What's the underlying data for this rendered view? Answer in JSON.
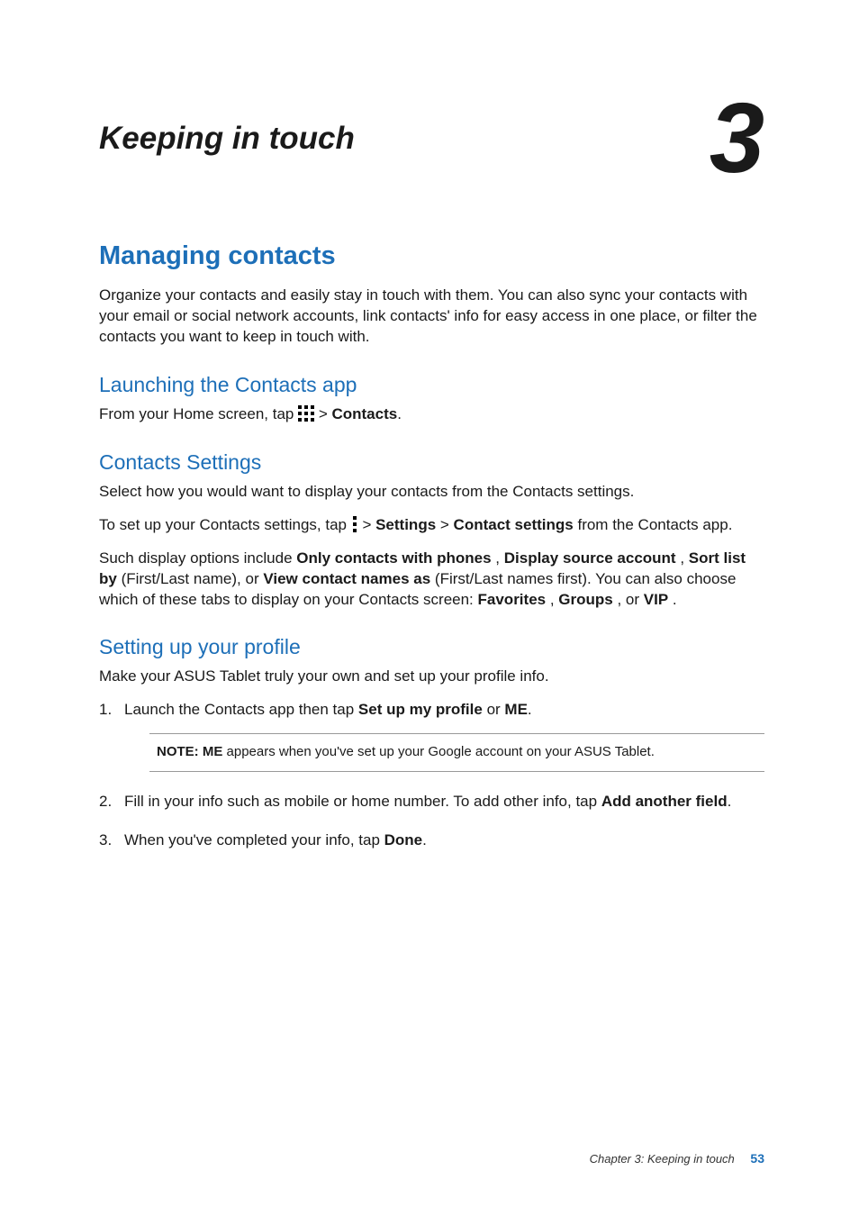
{
  "header": {
    "chapter_title": "Keeping in touch",
    "chapter_number": "3"
  },
  "section": {
    "title": "Managing contacts",
    "intro": "Organize your contacts and easily stay in touch with them. You can also sync your contacts with your email or social network accounts, link contacts' info for easy access in one place, or filter the contacts you want to keep in touch with."
  },
  "sub1": {
    "title": "Launching the Contacts app",
    "line_prefix": "From your Home screen, tap ",
    "gt": " > ",
    "contacts": "Contacts",
    "line_suffix": "."
  },
  "sub2": {
    "title": "Contacts Settings",
    "p1": "Select how you would want to display your contacts from the Contacts settings.",
    "p2_pre": "To set up your Contacts settings, tap ",
    "p2_gt1": " > ",
    "settings": "Settings",
    "p2_gt2": " > ",
    "contact_settings": "Contact settings",
    "p2_suffix": " from the Contacts app.",
    "p3_a": "Such display options include ",
    "only_contacts": "Only contacts with phones",
    "comma1": ", ",
    "display_source": "Display source account",
    "comma2": ", ",
    "sort_list": "Sort list by",
    "p3_b": " (First/Last name), or ",
    "view_names": "View contact names as",
    "p3_c": " (First/Last names first). You can also choose which of these tabs to display on your Contacts screen: ",
    "favorites": "Favorites",
    "comma3": ", ",
    "groups": "Groups",
    "or": ", or ",
    "vip": "VIP",
    "period": "."
  },
  "sub3": {
    "title": "Setting up your profile",
    "p1": "Make your ASUS Tablet truly your own and set up your profile info.",
    "step1_a": "Launch the Contacts app then tap ",
    "setup_profile": "Set up my profile",
    "step1_or": " or ",
    "me": "ME",
    "step1_end": ".",
    "note_label": "NOTE: ME",
    "note_text": " appears when you've set up your Google account on your ASUS Tablet.",
    "step2_a": "Fill in your info such as mobile or home number. To add other info, tap ",
    "add_field": "Add another field",
    "step2_end": ".",
    "step3_a": "When you've completed your info, tap ",
    "done": "Done",
    "step3_end": "."
  },
  "footer": {
    "label": "Chapter 3: Keeping in touch",
    "page": "53"
  }
}
